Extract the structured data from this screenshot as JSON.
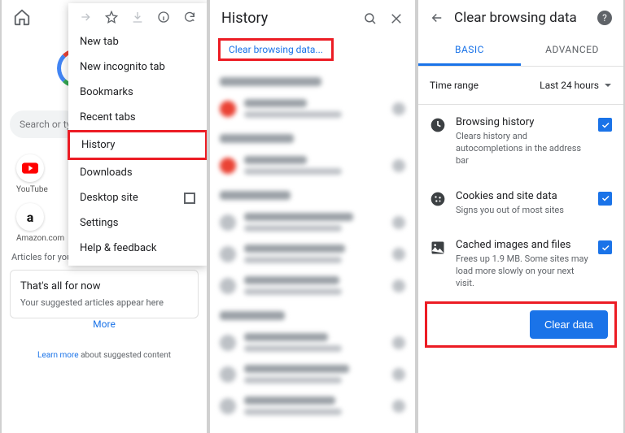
{
  "panel1": {
    "search_placeholder": "Search or ty",
    "shortcuts": [
      {
        "label": "YouTube"
      },
      {
        "label": "Amazon.com",
        "glyph": "a"
      }
    ],
    "articles_for_you": "Articles for you",
    "thats_all_title": "That's all for now",
    "thats_all_subtitle": "Your suggested articles appear here",
    "more_label": "More",
    "learn_more_link": "Learn more",
    "learn_more_rest": " about suggested content"
  },
  "menu": {
    "items": [
      "New tab",
      "New incognito tab",
      "Bookmarks",
      "Recent tabs",
      "History",
      "Downloads",
      "Desktop site",
      "Settings",
      "Help & feedback"
    ]
  },
  "history": {
    "title": "History",
    "clear_link": "Clear browsing data..."
  },
  "clear": {
    "title": "Clear browsing data",
    "tab_basic": "BASIC",
    "tab_advanced": "ADVANCED",
    "time_range_label": "Time range",
    "time_range_value": "Last 24 hours",
    "opts": [
      {
        "title": "Browsing history",
        "sub": "Clears history and autocompletions in the address bar"
      },
      {
        "title": "Cookies and site data",
        "sub": "Signs you out of most sites"
      },
      {
        "title": "Cached images and files",
        "sub": "Frees up 1.9 MB. Some sites may load more slowly on your next visit."
      }
    ],
    "button": "Clear data"
  }
}
